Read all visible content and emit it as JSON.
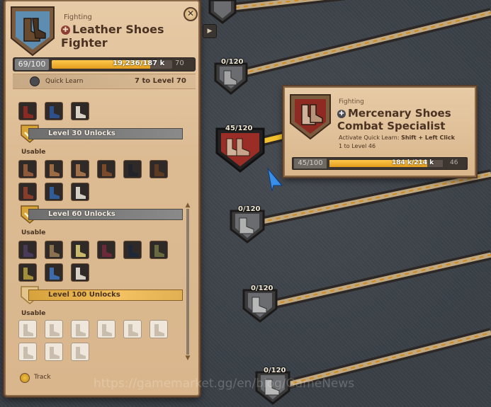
{
  "colors": {
    "accent_gold": "#e39d1e",
    "panel_bg": "#dcbb93",
    "panel_text": "#4a3322",
    "bar_bg": "#3d3530"
  },
  "panel": {
    "category": "Fighting",
    "title": "Leather Shoes Fighter",
    "title_icon": "fighting-emblem-icon",
    "level_current": "69/100",
    "level_progress_fraction": 0.82,
    "fame": "19,236/187 k",
    "next_level": "70",
    "quick_learn_label": "Quick Learn",
    "quick_learn_level": "7 to Level 70",
    "close_icon": "close-icon",
    "sections": [
      {
        "label": "Level 30 Unlocks",
        "usable": "Usable",
        "style": "grey"
      },
      {
        "label": "Level 60 Unlocks",
        "usable": "Usable",
        "style": "grey"
      },
      {
        "label": "Level 100 Unlocks",
        "usable": "Usable",
        "style": "gold"
      }
    ],
    "track_label": "Track"
  },
  "tooltip": {
    "category": "Fighting",
    "title": "Mercenary Shoes Combat Specialist",
    "quick_learn_prefix": "Activate Quick Learn:",
    "quick_learn_keys": "Shift + Left Click",
    "level_text": "1 to Level 46",
    "level_current": "45/100",
    "level_progress_fraction": 0.86,
    "fame": "184 k/214 k",
    "next_level": "46"
  },
  "tree_nodes": [
    {
      "count": "0/120"
    },
    {
      "count": "45/120"
    },
    {
      "count": "0/120"
    },
    {
      "count": "0/120"
    },
    {
      "count": "0/120"
    }
  ],
  "watermark": "https://gamemarket.gg/en/blog/GameNews"
}
